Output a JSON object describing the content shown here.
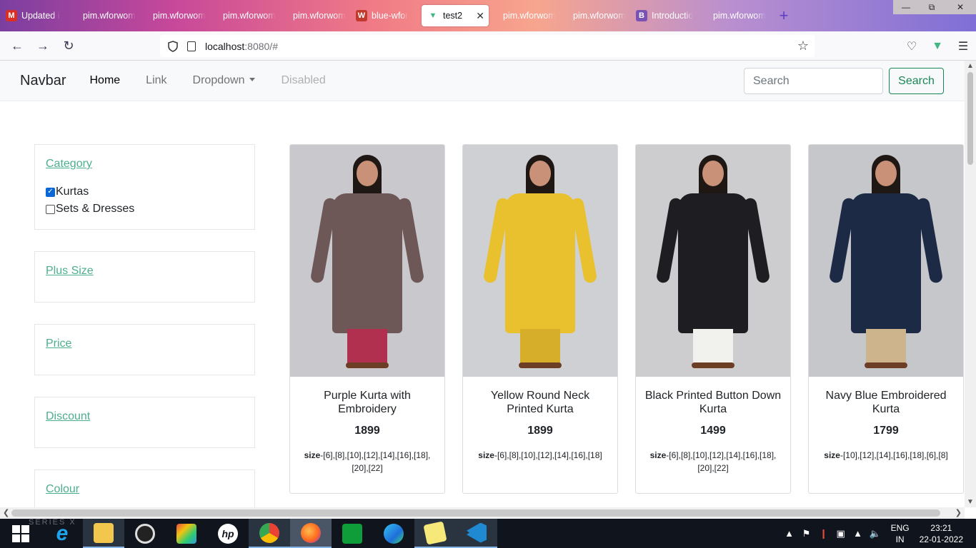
{
  "browser": {
    "tabs": [
      {
        "label": "Updated i",
        "icon": "gmail-icon",
        "color": "#d93025"
      },
      {
        "label": "pim.wforwom",
        "icon": "",
        "color": ""
      },
      {
        "label": "pim.wforwom",
        "icon": "",
        "color": ""
      },
      {
        "label": "pim.wforwom",
        "icon": "",
        "color": ""
      },
      {
        "label": "pim.wforwom",
        "icon": "",
        "color": ""
      },
      {
        "label": "blue-wfor",
        "icon": "w-brand-icon",
        "color": "#c0392b"
      },
      {
        "label": "test2",
        "icon": "vue-icon",
        "color": "#41b883",
        "active": true
      },
      {
        "label": "pim.wforwom",
        "icon": "",
        "color": ""
      },
      {
        "label": "pim.wforwom",
        "icon": "",
        "color": ""
      },
      {
        "label": "Introductio",
        "icon": "bootstrap-icon",
        "color": "#7952b3"
      },
      {
        "label": "pim.wforwom",
        "icon": "",
        "color": ""
      }
    ],
    "url_host": "localhost",
    "url_rest": ":8080/#"
  },
  "site": {
    "brand": "Navbar",
    "nav": {
      "home": "Home",
      "link": "Link",
      "dropdown": "Dropdown",
      "disabled": "Disabled"
    },
    "search": {
      "placeholder": "Search",
      "button": "Search"
    }
  },
  "filters": {
    "category": {
      "title": "Category",
      "options": [
        {
          "label": "Kurtas",
          "checked": true
        },
        {
          "label": "Sets & Dresses",
          "checked": false
        }
      ]
    },
    "plus_size": "Plus Size",
    "price": "Price",
    "discount": "Discount",
    "colour": "Colour"
  },
  "products": [
    {
      "title": "Purple Kurta with Embroidery",
      "price": "1899",
      "size_label": "size",
      "sizes": "-[6],[8],[10],[12],[14],[16],[18],[20],[22]",
      "kurta_color": "#6e5857",
      "bottom_color": "#b2304f",
      "bg": "#c9c8cc"
    },
    {
      "title": "Yellow Round Neck Printed Kurta",
      "price": "1899",
      "size_label": "size",
      "sizes": "-[6],[8],[10],[12],[14],[16],[18]",
      "kurta_color": "#e9c02e",
      "bottom_color": "#d6ae2a",
      "bg": "#cfd0d3"
    },
    {
      "title": "Black Printed Button Down Kurta",
      "price": "1499",
      "size_label": "size",
      "sizes": "-[6],[8],[10],[12],[14],[16],[18],[20],[22]",
      "kurta_color": "#1d1d22",
      "bottom_color": "#f1f1ee",
      "bg": "#cdcdd0"
    },
    {
      "title": "Navy Blue Embroidered Kurta",
      "price": "1799",
      "size_label": "size",
      "sizes": "-[10],[12],[14],[16],[18],[6],[8]",
      "kurta_color": "#1c2a45",
      "bottom_color": "#cdb48d",
      "bg": "#c6c7cb"
    }
  ],
  "taskbar": {
    "lang_top": "ENG",
    "lang_bottom": "IN",
    "time": "23:21",
    "date": "22-01-2022"
  },
  "watermark": "SERIES X"
}
